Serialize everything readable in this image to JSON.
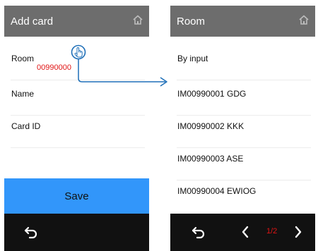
{
  "left_screen": {
    "title": "Add card",
    "icons": {
      "home": "home-icon",
      "back": "back-arrow-icon"
    },
    "fields": [
      {
        "label": "Room",
        "value": "00990000"
      },
      {
        "label": "Name"
      },
      {
        "label": "Card ID"
      }
    ],
    "save_label": "Save"
  },
  "right_screen": {
    "title": "Room",
    "icons": {
      "home": "home-icon",
      "back": "back-arrow-icon",
      "prev": "chevron-left-icon",
      "next": "chevron-right-icon"
    },
    "items": [
      "By input",
      "IM00990001 GDG",
      "IM00990002 KKK",
      "IM00990003 ASE",
      "IM00990004 EWIOG"
    ],
    "page_indicator": "1/2"
  },
  "annotation": {
    "tap_icon": "tap-hand-icon",
    "arrow_color": "#1e6fb8"
  },
  "colors": {
    "header_bg": "#6d6d6d",
    "footer_bg": "#111111",
    "save_bg": "#3296fa",
    "highlight_text": "#e01414"
  }
}
